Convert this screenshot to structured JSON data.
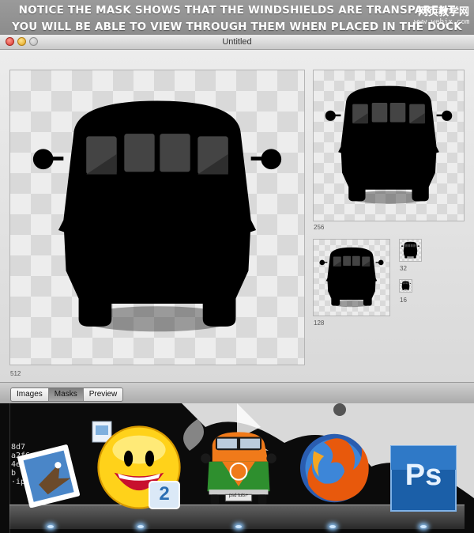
{
  "banner": {
    "line1": "NOTICE THE MASK SHOWS THAT THE WINDSHIELDS ARE TRANSPARENT",
    "line2": "YOU WILL BE ABLE TO VIEW THROUGH THEM WHEN PLACED IN THE DOCK",
    "watermark_title": "网页教学网",
    "watermark_url": "www.webjx.com"
  },
  "window": {
    "title": "Untitled"
  },
  "previews": {
    "size_512": "512",
    "size_256": "256",
    "size_128": "128",
    "size_32": "32",
    "size_16": "16"
  },
  "tabs": {
    "images": "Images",
    "masks": "Masks",
    "preview": "Preview",
    "selected": "Masks"
  },
  "dock": {
    "mail_background_text": "8d7\na2f6\n4e\nb\n·ipg",
    "yahoo_badge": "2",
    "bus_plate": "psd tuts+",
    "photoshop_label": "Ps"
  },
  "colors": {
    "mask": "#000000",
    "titlebar": "#d6d6d6",
    "photoshop": "#1b5fa8",
    "bus_orange": "#f07a1a",
    "bus_green": "#2e8f2e"
  }
}
